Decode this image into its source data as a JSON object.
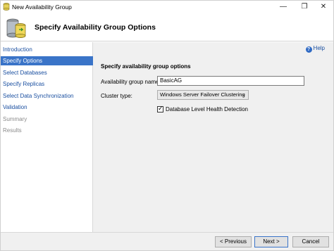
{
  "window": {
    "title": "New Availability Group",
    "controls": {
      "minimize": "—",
      "maximize": "❐",
      "close": "✕"
    }
  },
  "header": {
    "title": "Specify Availability Group Options"
  },
  "nav": {
    "items": [
      {
        "label": "Introduction",
        "state": "link"
      },
      {
        "label": "Specify Options",
        "state": "active"
      },
      {
        "label": "Select Databases",
        "state": "link"
      },
      {
        "label": "Specify Replicas",
        "state": "link"
      },
      {
        "label": "Select Data Synchronization",
        "state": "link"
      },
      {
        "label": "Validation",
        "state": "link"
      },
      {
        "label": "Summary",
        "state": "disabled"
      },
      {
        "label": "Results",
        "state": "disabled"
      }
    ]
  },
  "main": {
    "help_label": "Help",
    "section_title": "Specify availability group options",
    "ag_name_label": "Availability group name:",
    "ag_name_value": "BasicAG",
    "cluster_type_label": "Cluster type:",
    "cluster_type_value": "Windows Server Failover Clustering",
    "health_detection_label": "Database Level Health Detection",
    "health_detection_checked": true
  },
  "footer": {
    "previous_label": "< Previous",
    "next_label": "Next >",
    "cancel_label": "Cancel"
  },
  "colors": {
    "accent": "#3a74c8",
    "link": "#1a4fa0",
    "panel": "#f0f0f0"
  }
}
